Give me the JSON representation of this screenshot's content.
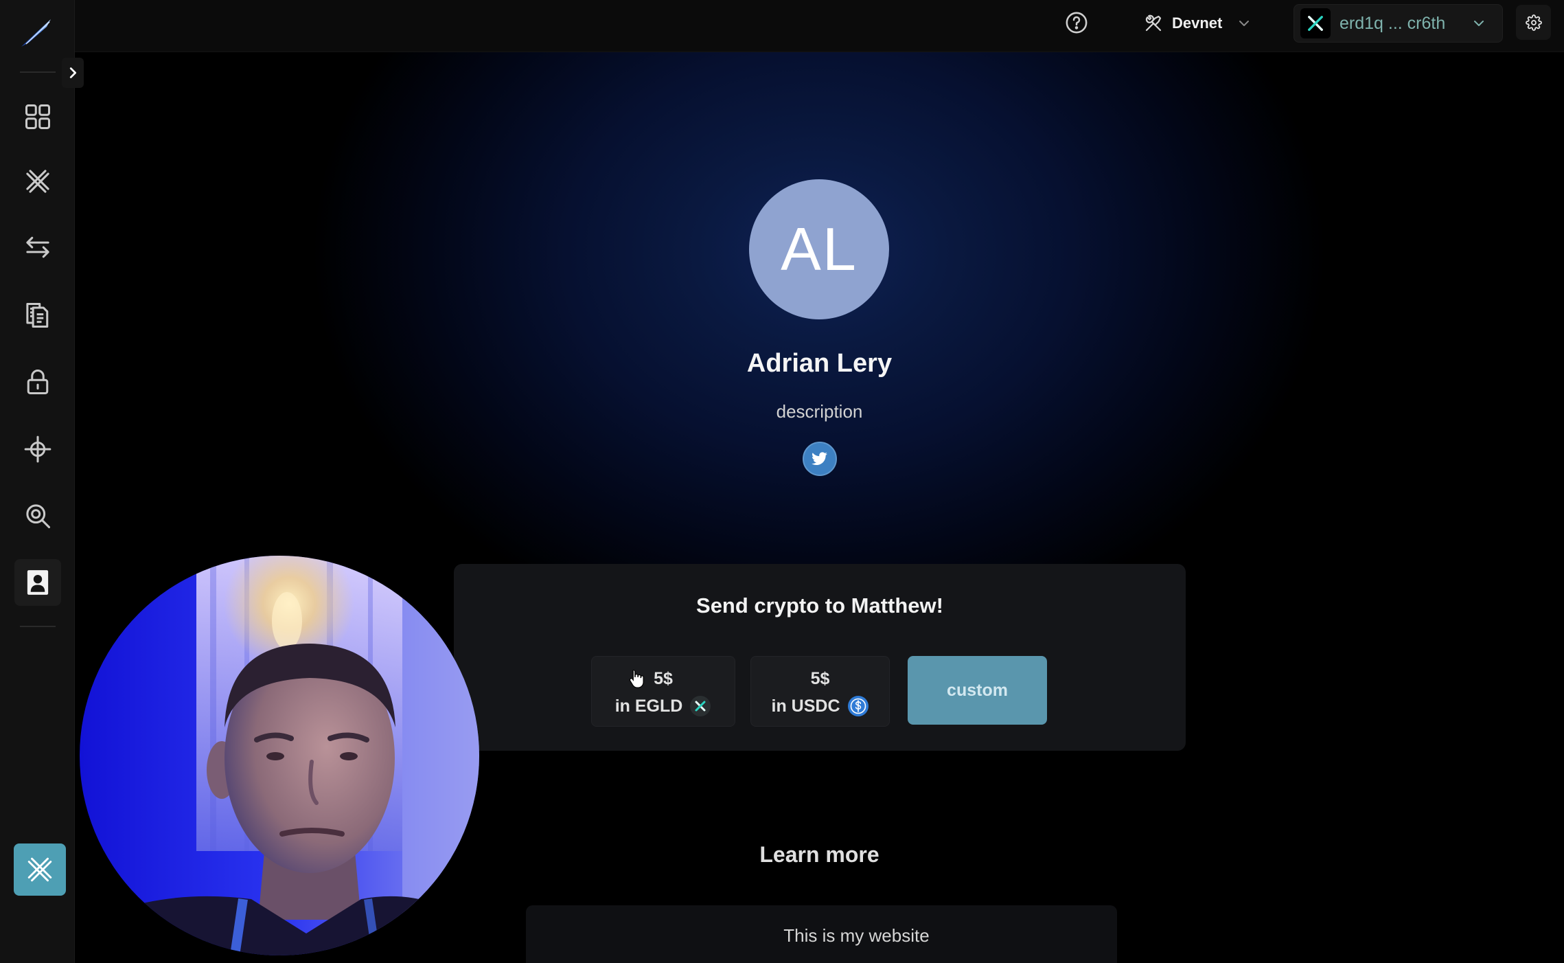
{
  "sidebar": {
    "logo_icon": "multiversx-blade-logo",
    "toggle_icon": "chevron-right-icon",
    "items": [
      {
        "icon": "grid-icon"
      },
      {
        "icon": "multiversx-x-icon"
      },
      {
        "icon": "transfer-arrows-icon"
      },
      {
        "icon": "documents-icon"
      },
      {
        "icon": "lock-icon"
      },
      {
        "icon": "crosshair-icon"
      },
      {
        "icon": "search-icon"
      },
      {
        "icon": "profile-user-icon"
      }
    ],
    "active_icon": "profile-user-icon",
    "bottom_button_icon": "multiversx-x-icon"
  },
  "topbar": {
    "help_icon": "help-circle-icon",
    "network_icon": "tools-icon",
    "network": "Devnet",
    "wallet_icon": "multiversx-x-icon",
    "wallet_address": "erd1q ... cr6th",
    "settings_icon": "gear-icon"
  },
  "profile": {
    "initials": "AL",
    "name": "Adrian Lery",
    "description": "description",
    "socials": [
      {
        "icon": "twitter-icon"
      }
    ]
  },
  "donate": {
    "title": "Send crypto to Matthew!",
    "options": [
      {
        "amount": "5$",
        "token": "in EGLD",
        "token_icon": "egld-icon"
      },
      {
        "amount": "5$",
        "token": "in USDC",
        "token_icon": "usdc-icon"
      }
    ],
    "custom_label": "custom"
  },
  "learn_more": {
    "title": "Learn more",
    "links": [
      {
        "label": "This is my website"
      }
    ]
  },
  "colors": {
    "avatar": "#8fa3d0",
    "accent": "#5a96ad",
    "wallet_text": "#7fb3ad",
    "twitter": "#3d80c2",
    "usdc": "#2f7bd6",
    "bottom_button": "#4e9fb4"
  }
}
